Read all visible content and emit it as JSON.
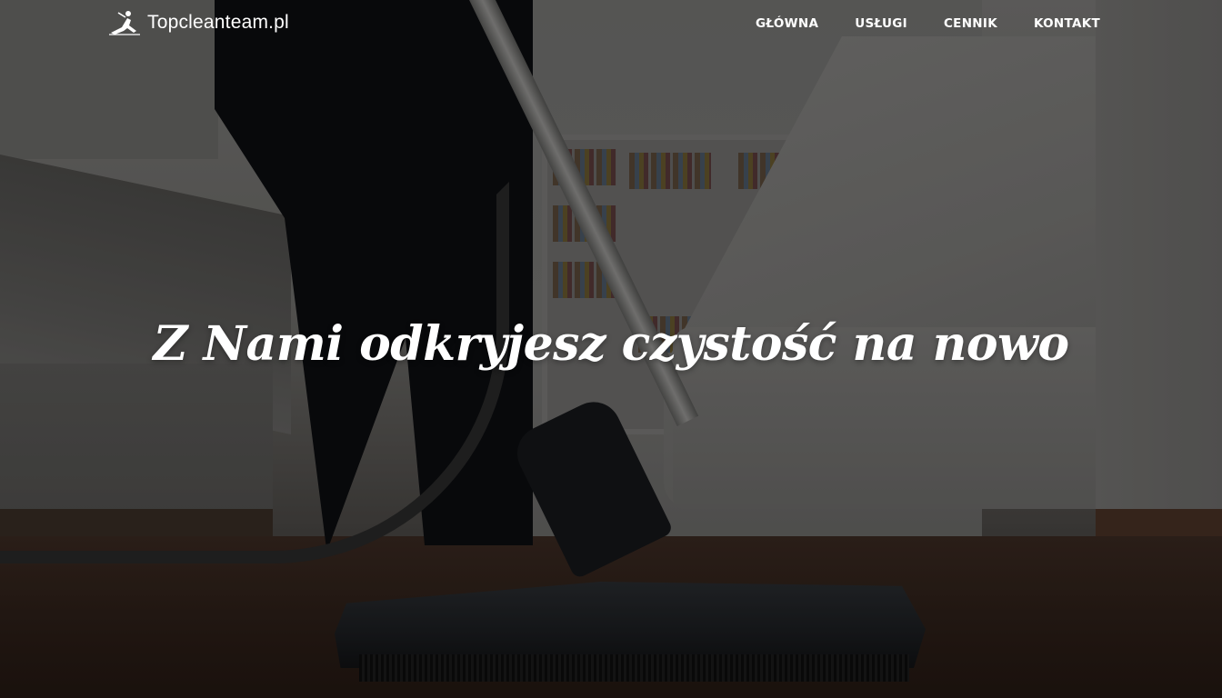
{
  "brand": {
    "name": "Topcleanteam.pl",
    "icon": "cleaner-figure-icon"
  },
  "nav": {
    "items": [
      {
        "label": "GŁÓWNA"
      },
      {
        "label": "USŁUGI"
      },
      {
        "label": "CENNIK"
      },
      {
        "label": "KONTAKT"
      }
    ]
  },
  "hero": {
    "headline": "Z Nami odkryjesz czystość na nowo",
    "background": "vacuum-cleaner-photo"
  },
  "colors": {
    "text": "#ffffff",
    "overlay": "#000000"
  }
}
